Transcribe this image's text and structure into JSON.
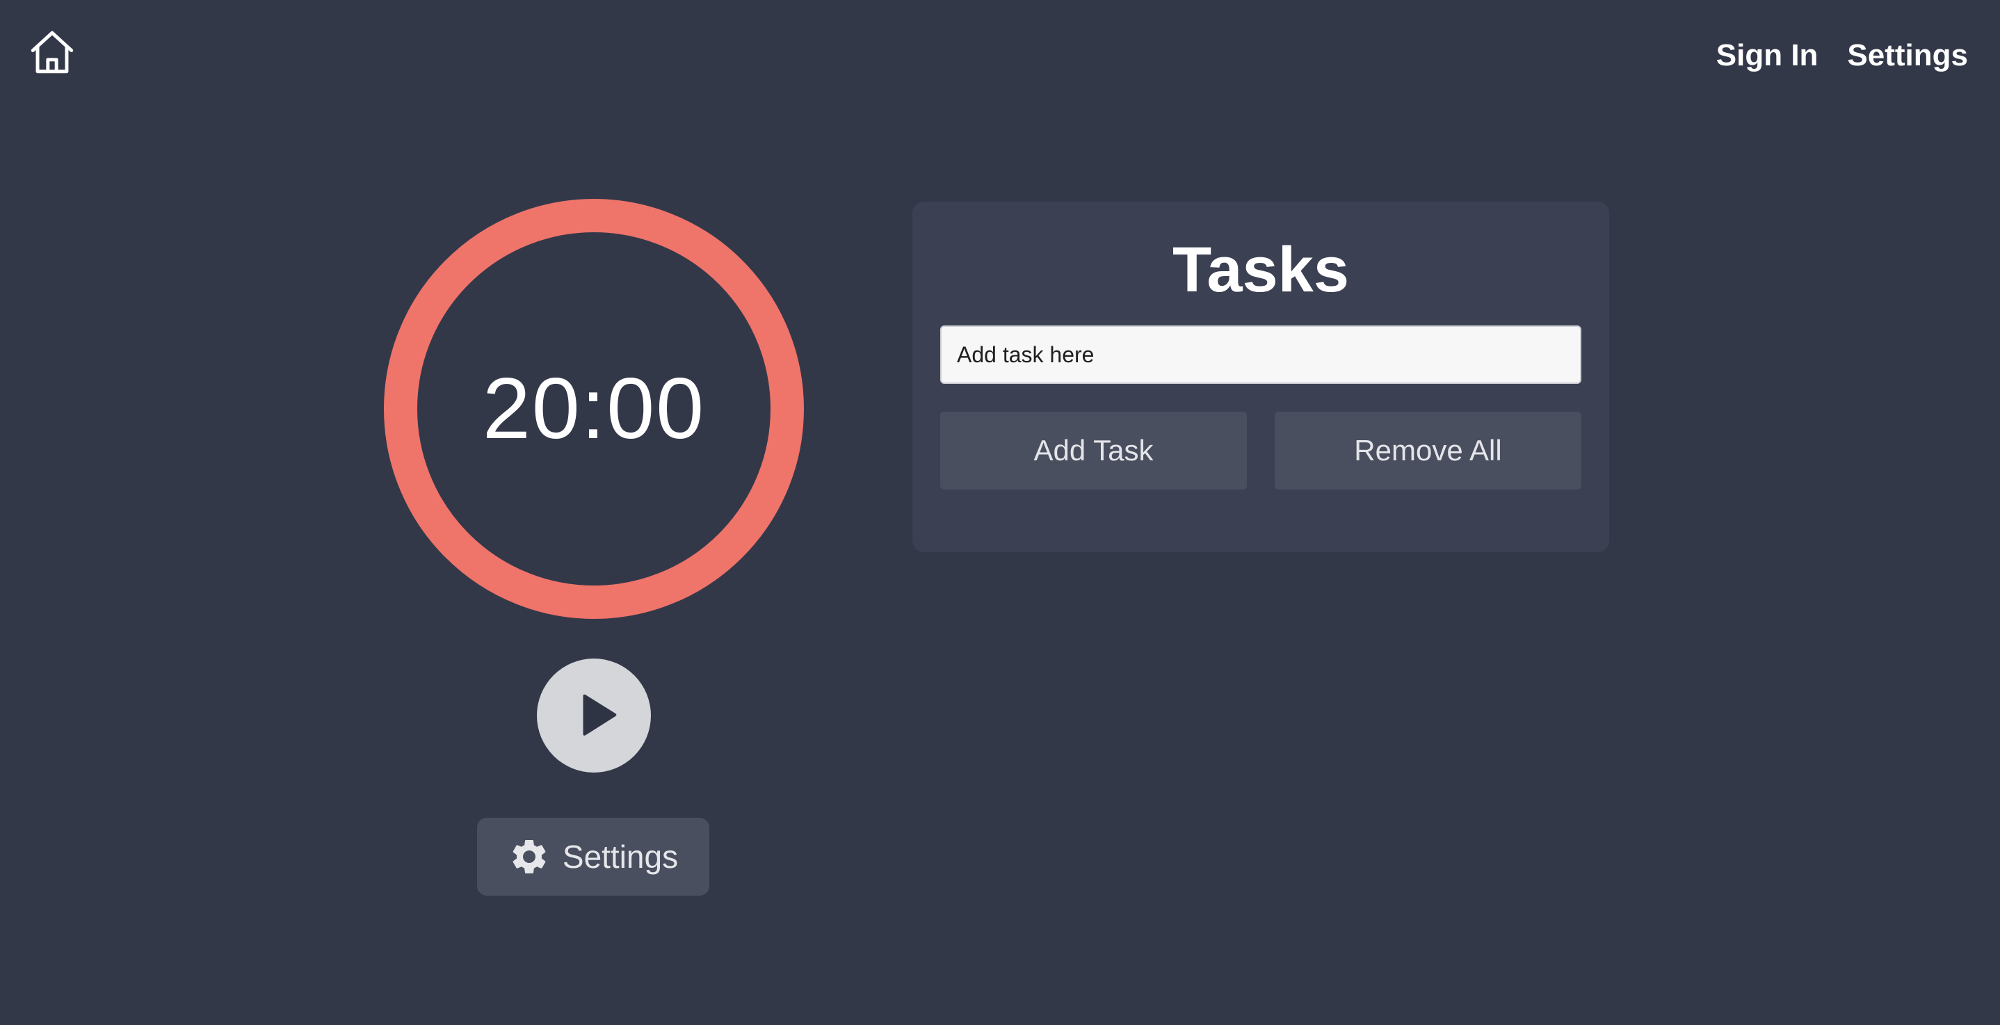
{
  "nav": {
    "home_icon": "home-icon",
    "sign_in_label": "Sign In",
    "settings_label": "Settings"
  },
  "timer": {
    "display": "20:00",
    "ring_color": "#ef746a",
    "play_icon": "play-icon",
    "settings_icon": "gear-icon",
    "settings_label": "Settings"
  },
  "tasks": {
    "title": "Tasks",
    "input_placeholder": "Add task here",
    "input_value": "",
    "add_label": "Add Task",
    "remove_all_label": "Remove All"
  },
  "colors": {
    "background": "#333849",
    "panel": "#3b4052",
    "button": "#4a4f5f",
    "accent": "#ef746a"
  }
}
